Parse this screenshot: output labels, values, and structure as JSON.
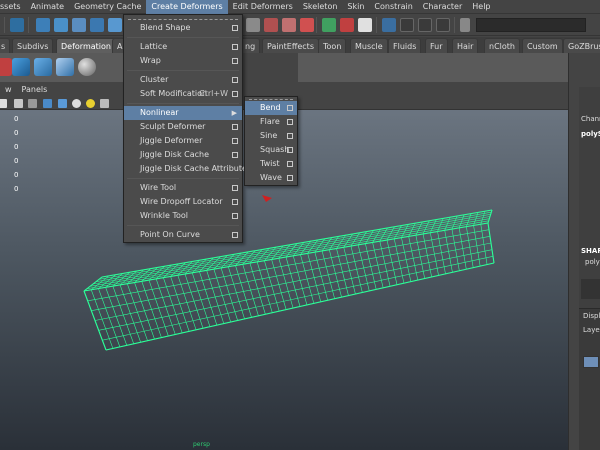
{
  "menubar": {
    "items": [
      "ssets",
      "Animate",
      "Geometry Cache",
      "Create Deformers",
      "Edit Deformers",
      "Skeleton",
      "Skin",
      "Constrain",
      "Character",
      "Help"
    ]
  },
  "shelf": {
    "tabs": [
      "s",
      "Subdivs",
      "Deformation",
      "A",
      "PaintEffects",
      "Toon",
      "Muscle",
      "Fluids",
      "Fur",
      "Hair",
      "nCloth",
      "Custom",
      "GoZBrush"
    ],
    "partial_tab": "ng",
    "active_tab_index": 2
  },
  "panel_menu": {
    "items": [
      "w",
      "Panels"
    ]
  },
  "hud": {
    "values": [
      "0",
      "0",
      "0",
      "0",
      "0",
      "0"
    ]
  },
  "viewport": {
    "axis_label": "persp"
  },
  "create_deformers_menu": {
    "items": [
      {
        "label": "Blend Shape",
        "option": true
      },
      {
        "label": "Lattice",
        "option": true
      },
      {
        "label": "Wrap",
        "option": true
      },
      {
        "label": "Cluster",
        "option": true
      },
      {
        "label": "Soft Modification",
        "shortcut": "Ctrl+W",
        "option": true
      },
      {
        "label": "Nonlinear",
        "submenu": true,
        "highlighted": true
      },
      {
        "label": "Sculpt Deformer",
        "option": true
      },
      {
        "label": "Jiggle Deformer",
        "option": true
      },
      {
        "label": "Jiggle Disk Cache",
        "option": true
      },
      {
        "label": "Jiggle Disk Cache Attributes"
      },
      {
        "label": "Wire Tool",
        "option": true
      },
      {
        "label": "Wire Dropoff Locator",
        "option": true
      },
      {
        "label": "Wrinkle Tool",
        "option": true
      },
      {
        "label": "Point On Curve",
        "option": true
      }
    ]
  },
  "nonlinear_menu": {
    "items": [
      {
        "label": "Bend",
        "highlighted": true
      },
      {
        "label": "Flare"
      },
      {
        "label": "Sine"
      },
      {
        "label": "Squash"
      },
      {
        "label": "Twist"
      },
      {
        "label": "Wave"
      }
    ]
  },
  "right_panel": {
    "channel_label": "Chann",
    "object_label": "polyS",
    "shapes_label": "SHAP",
    "shape_item": "poly",
    "display_tab": "Displ",
    "layers_label": "Laye"
  },
  "colors": {
    "menu_highlight": "#5e7fa4",
    "mesh_wire": "#2bff98",
    "background_top": "#707a86",
    "background_bottom": "#2a3038"
  },
  "icons": [
    "move-tool-icon",
    "rotate-tool-icon",
    "scale-tool-icon",
    "snap-grid-icon",
    "snap-curve-icon",
    "snap-point-icon",
    "render-icon",
    "ipr-render-icon",
    "render-settings-icon",
    "hypershade-icon",
    "polygon-cube-icon",
    "polygon-sphere-icon",
    "nurbs-plane-icon",
    "camera-icon",
    "wireframe-icon",
    "smooth-shade-icon",
    "light-icon"
  ]
}
